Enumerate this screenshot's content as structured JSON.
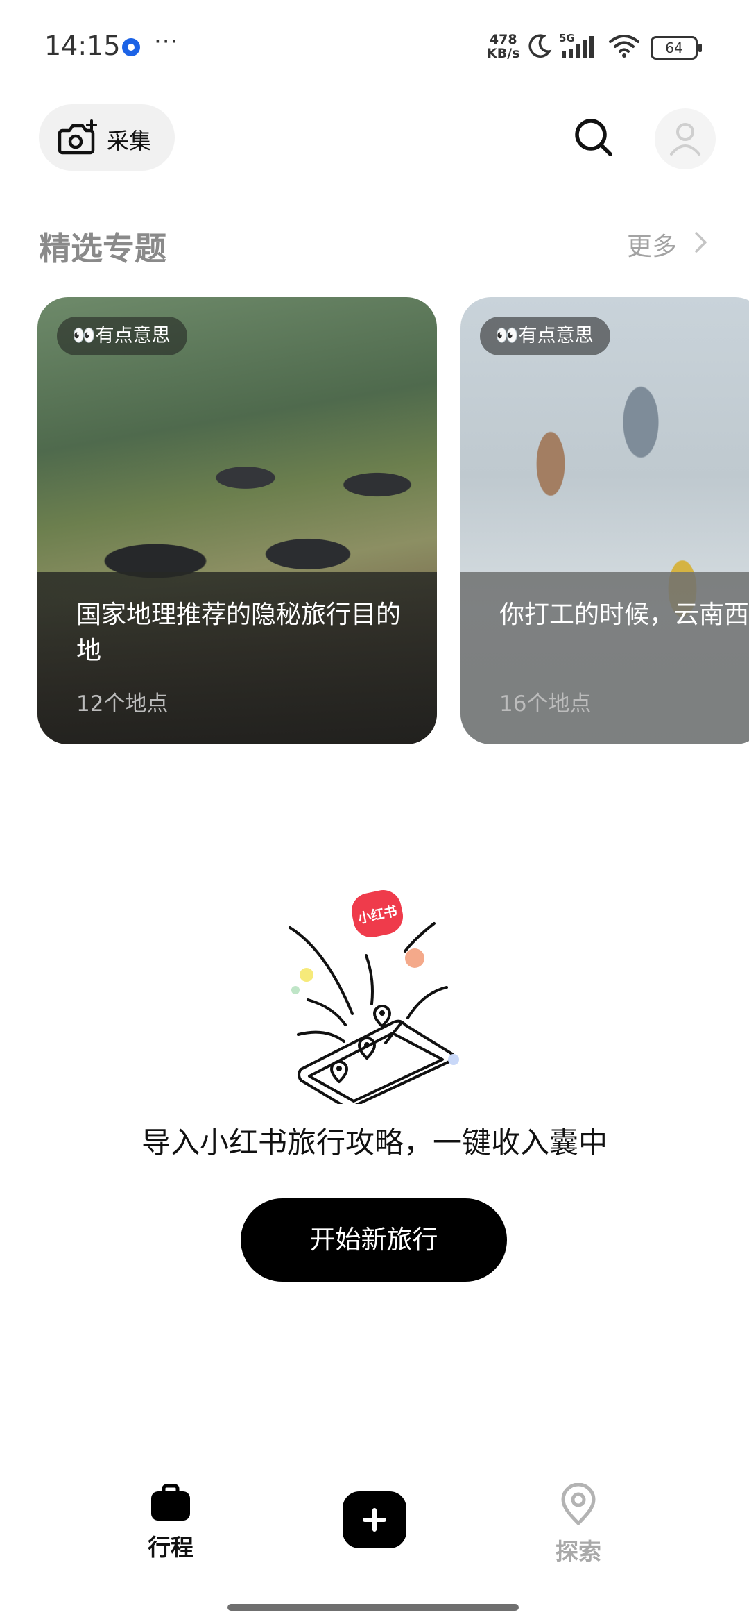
{
  "status_bar": {
    "time": "14:15",
    "more": "···",
    "net_speed_value": "478",
    "net_speed_unit": "KB/s",
    "network": "5G",
    "battery": "64"
  },
  "header": {
    "collect_label": "采集"
  },
  "featured": {
    "title": "精选专题",
    "more_label": "更多",
    "cards": [
      {
        "tag": "👀有点意思",
        "title": "国家地理推荐的隐秘旅行目的地",
        "places": "12个地点"
      },
      {
        "tag": "👀有点意思",
        "title": "你打工的时候，云南西high起来了",
        "places": "16个地点"
      }
    ]
  },
  "empty_state": {
    "badge": "小红书",
    "message": "导入小红书旅行攻略，一键收入囊中",
    "start_button": "开始新旅行"
  },
  "bottom_nav": {
    "trip_label": "行程",
    "explore_label": "探索"
  },
  "colors": {
    "primary": "#000000",
    "muted_text": "#8a8a8a",
    "xhs_red": "#ef3b4b"
  }
}
